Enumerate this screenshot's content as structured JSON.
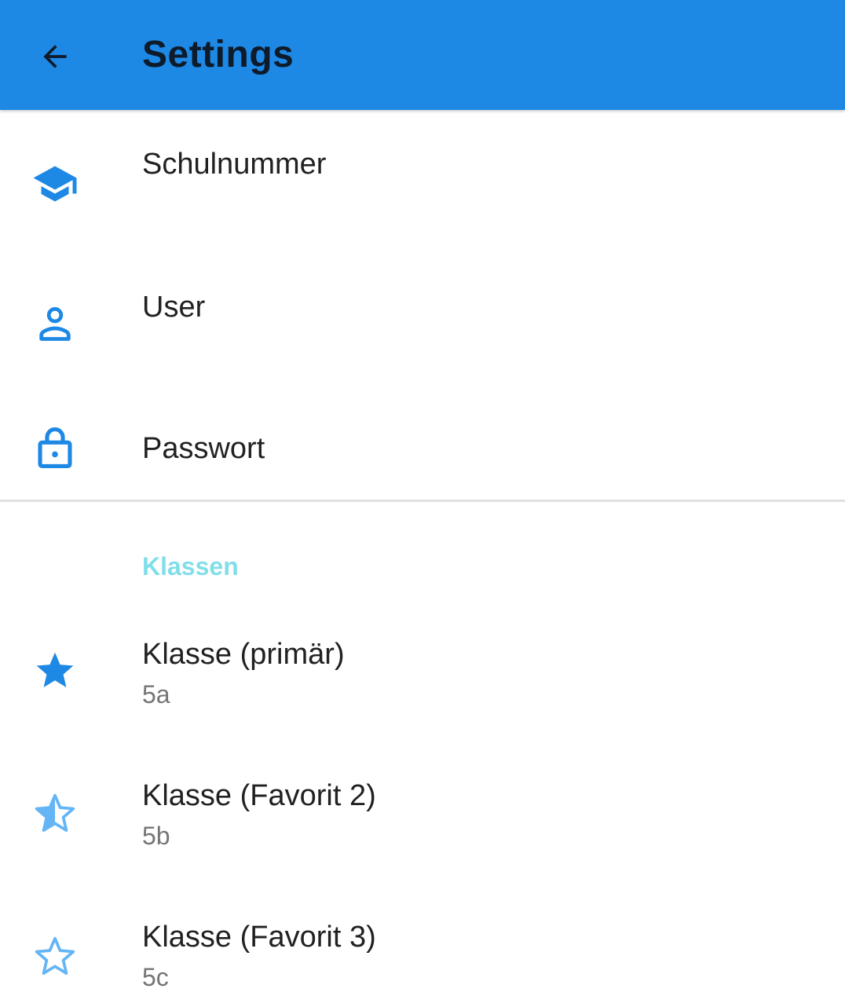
{
  "app_bar": {
    "title": "Settings",
    "back_icon": "arrow-back-icon",
    "background": "#1e88e5"
  },
  "account": {
    "items": [
      {
        "title": "Schulnummer",
        "icon": "school-cap-icon"
      },
      {
        "title": "User",
        "icon": "person-icon"
      },
      {
        "title": "Passwort",
        "icon": "lock-icon"
      }
    ]
  },
  "classes": {
    "header": "Klassen",
    "header_color": "#80deea",
    "items": [
      {
        "title": "Klasse (primär)",
        "value": "5a",
        "icon": "star-filled-icon"
      },
      {
        "title": "Klasse (Favorit 2)",
        "value": "5b",
        "icon": "star-half-icon"
      },
      {
        "title": "Klasse (Favorit 3)",
        "value": "5c",
        "icon": "star-outline-icon"
      }
    ]
  },
  "colors": {
    "icon_blue": "#1e88e5",
    "icon_light_blue": "#64b5f6"
  }
}
